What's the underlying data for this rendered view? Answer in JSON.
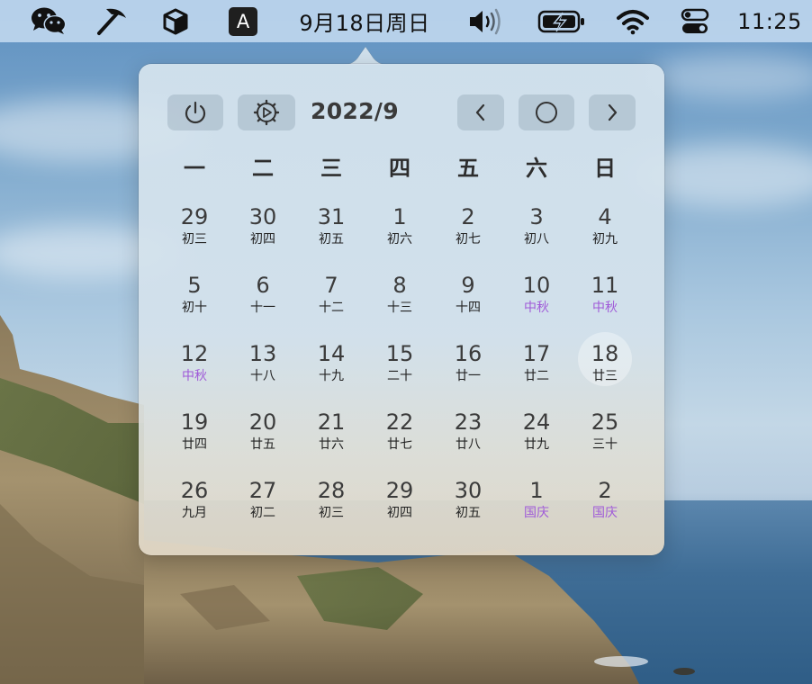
{
  "menubar": {
    "items": [
      {
        "name": "wechat-icon"
      },
      {
        "name": "pickaxe-icon"
      },
      {
        "name": "box-icon"
      },
      {
        "name": "input-method-icon",
        "label": "A"
      }
    ],
    "date": "9月18日周日",
    "time": "11:25",
    "status_icons": [
      "volume-icon",
      "battery-charging-icon",
      "wifi-icon",
      "control-center-icon"
    ]
  },
  "calendar": {
    "title": "2022/9",
    "toolbar": {
      "power_icon": "power-icon",
      "settings_icon": "settings-icon",
      "prev_icon": "chevron-left-icon",
      "today_icon": "circle-icon",
      "next_icon": "chevron-right-icon"
    },
    "weekdays": [
      "一",
      "二",
      "三",
      "四",
      "五",
      "六",
      "日"
    ],
    "weeks": [
      [
        {
          "day": "29",
          "lunar": "初三"
        },
        {
          "day": "30",
          "lunar": "初四"
        },
        {
          "day": "31",
          "lunar": "初五"
        },
        {
          "day": "1",
          "lunar": "初六"
        },
        {
          "day": "2",
          "lunar": "初七"
        },
        {
          "day": "3",
          "lunar": "初八"
        },
        {
          "day": "4",
          "lunar": "初九"
        }
      ],
      [
        {
          "day": "5",
          "lunar": "初十"
        },
        {
          "day": "6",
          "lunar": "十一"
        },
        {
          "day": "7",
          "lunar": "十二"
        },
        {
          "day": "8",
          "lunar": "十三"
        },
        {
          "day": "9",
          "lunar": "十四"
        },
        {
          "day": "10",
          "lunar": "中秋",
          "holiday": true
        },
        {
          "day": "11",
          "lunar": "中秋",
          "holiday": true
        }
      ],
      [
        {
          "day": "12",
          "lunar": "中秋",
          "holiday": true
        },
        {
          "day": "13",
          "lunar": "十八"
        },
        {
          "day": "14",
          "lunar": "十九"
        },
        {
          "day": "15",
          "lunar": "二十"
        },
        {
          "day": "16",
          "lunar": "廿一"
        },
        {
          "day": "17",
          "lunar": "廿二"
        },
        {
          "day": "18",
          "lunar": "廿三",
          "today": true
        }
      ],
      [
        {
          "day": "19",
          "lunar": "廿四"
        },
        {
          "day": "20",
          "lunar": "廿五"
        },
        {
          "day": "21",
          "lunar": "廿六"
        },
        {
          "day": "22",
          "lunar": "廿七"
        },
        {
          "day": "23",
          "lunar": "廿八"
        },
        {
          "day": "24",
          "lunar": "廿九"
        },
        {
          "day": "25",
          "lunar": "三十"
        }
      ],
      [
        {
          "day": "26",
          "lunar": "九月"
        },
        {
          "day": "27",
          "lunar": "初二"
        },
        {
          "day": "28",
          "lunar": "初三"
        },
        {
          "day": "29",
          "lunar": "初四"
        },
        {
          "day": "30",
          "lunar": "初五"
        },
        {
          "day": "1",
          "lunar": "国庆",
          "holiday": true
        },
        {
          "day": "2",
          "lunar": "国庆",
          "holiday": true
        }
      ]
    ]
  },
  "colors": {
    "holiday": "#a05ad8",
    "menubar": "#bed6ee"
  }
}
